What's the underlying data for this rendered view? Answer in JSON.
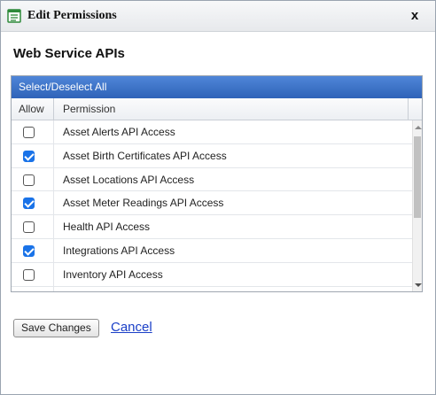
{
  "dialog": {
    "title": "Edit Permissions",
    "close_label": "x",
    "title_icon": "form-list-icon"
  },
  "section_title": "Web Service APIs",
  "select_all_label": "Select/Deselect All",
  "grid": {
    "columns": [
      "Allow",
      "Permission"
    ],
    "rows": [
      {
        "checked": false,
        "permission": "Asset Alerts API Access"
      },
      {
        "checked": true,
        "permission": "Asset Birth Certificates API Access"
      },
      {
        "checked": false,
        "permission": "Asset Locations API Access"
      },
      {
        "checked": true,
        "permission": "Asset Meter Readings API Access"
      },
      {
        "checked": false,
        "permission": "Health API Access"
      },
      {
        "checked": true,
        "permission": "Integrations API Access"
      },
      {
        "checked": false,
        "permission": "Inventory API Access"
      },
      {
        "checked": false,
        "permission": ""
      }
    ]
  },
  "actions": {
    "save_label": "Save Changes",
    "cancel_label": "Cancel"
  },
  "colors": {
    "select_all_bar": "#3a70c8",
    "checkbox_checked": "#1a73e8",
    "link": "#1a3fc7"
  }
}
